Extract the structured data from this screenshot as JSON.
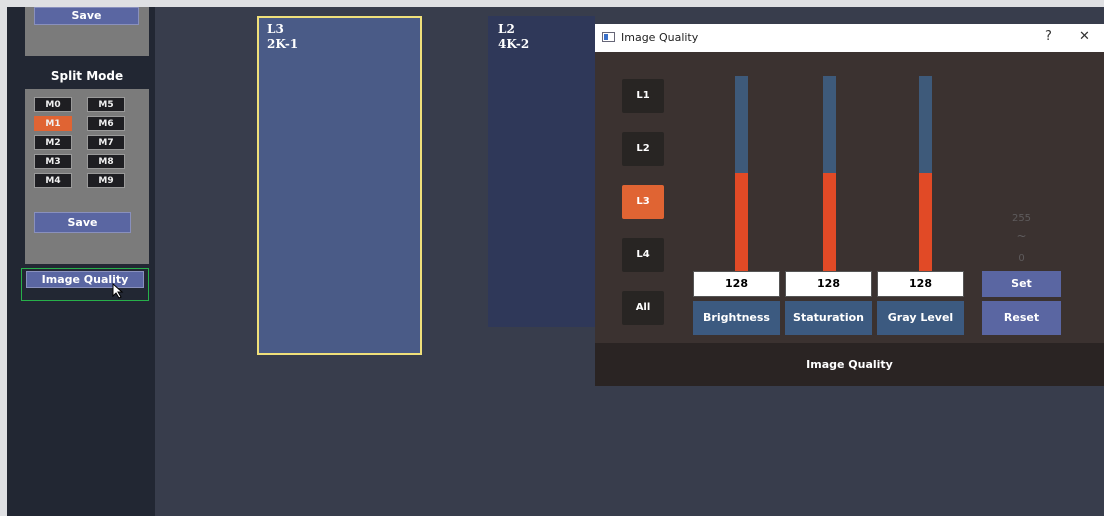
{
  "sidebar": {
    "save_top": "Save",
    "split_mode_title": "Split Mode",
    "modes": [
      {
        "label": "M0",
        "active": false
      },
      {
        "label": "M5",
        "active": false
      },
      {
        "label": "M1",
        "active": true
      },
      {
        "label": "M6",
        "active": false
      },
      {
        "label": "M2",
        "active": false
      },
      {
        "label": "M7",
        "active": false
      },
      {
        "label": "M3",
        "active": false
      },
      {
        "label": "M8",
        "active": false
      },
      {
        "label": "M4",
        "active": false
      },
      {
        "label": "M9",
        "active": false
      }
    ],
    "save_bottom": "Save",
    "image_quality_button": "Image Quality"
  },
  "canvas": {
    "layer_l3": {
      "name": "L3",
      "source": "2K-1"
    },
    "layer_l2": {
      "name": "L2",
      "source": "4K-2"
    }
  },
  "dialog": {
    "title": "Image Quality",
    "help": "?",
    "close": "✕",
    "layers": [
      "L1",
      "L2",
      "L3",
      "L4",
      "All"
    ],
    "active_layer": "L3",
    "sliders": [
      {
        "label": "Brightness",
        "value": "128",
        "level": 0.5
      },
      {
        "label": "Staturation",
        "value": "128",
        "level": 0.5
      },
      {
        "label": "Gray Level Bias",
        "value": "128",
        "level": 0.5
      }
    ],
    "range_max": "255",
    "range_sep": "~",
    "range_min": "0",
    "set": "Set",
    "reset": "Reset",
    "footer": "Image Quality"
  },
  "colors": {
    "accent_orange": "#e06433",
    "slider_fill": "#e14a26",
    "slider_track": "#3e5a7a",
    "button_blue": "#5a66a2",
    "selection_yellow": "#f0e07a",
    "focus_green": "#27b04a"
  },
  "icons": {
    "dialog_icon": "window-icon",
    "cursor": "mouse-pointer-icon"
  }
}
